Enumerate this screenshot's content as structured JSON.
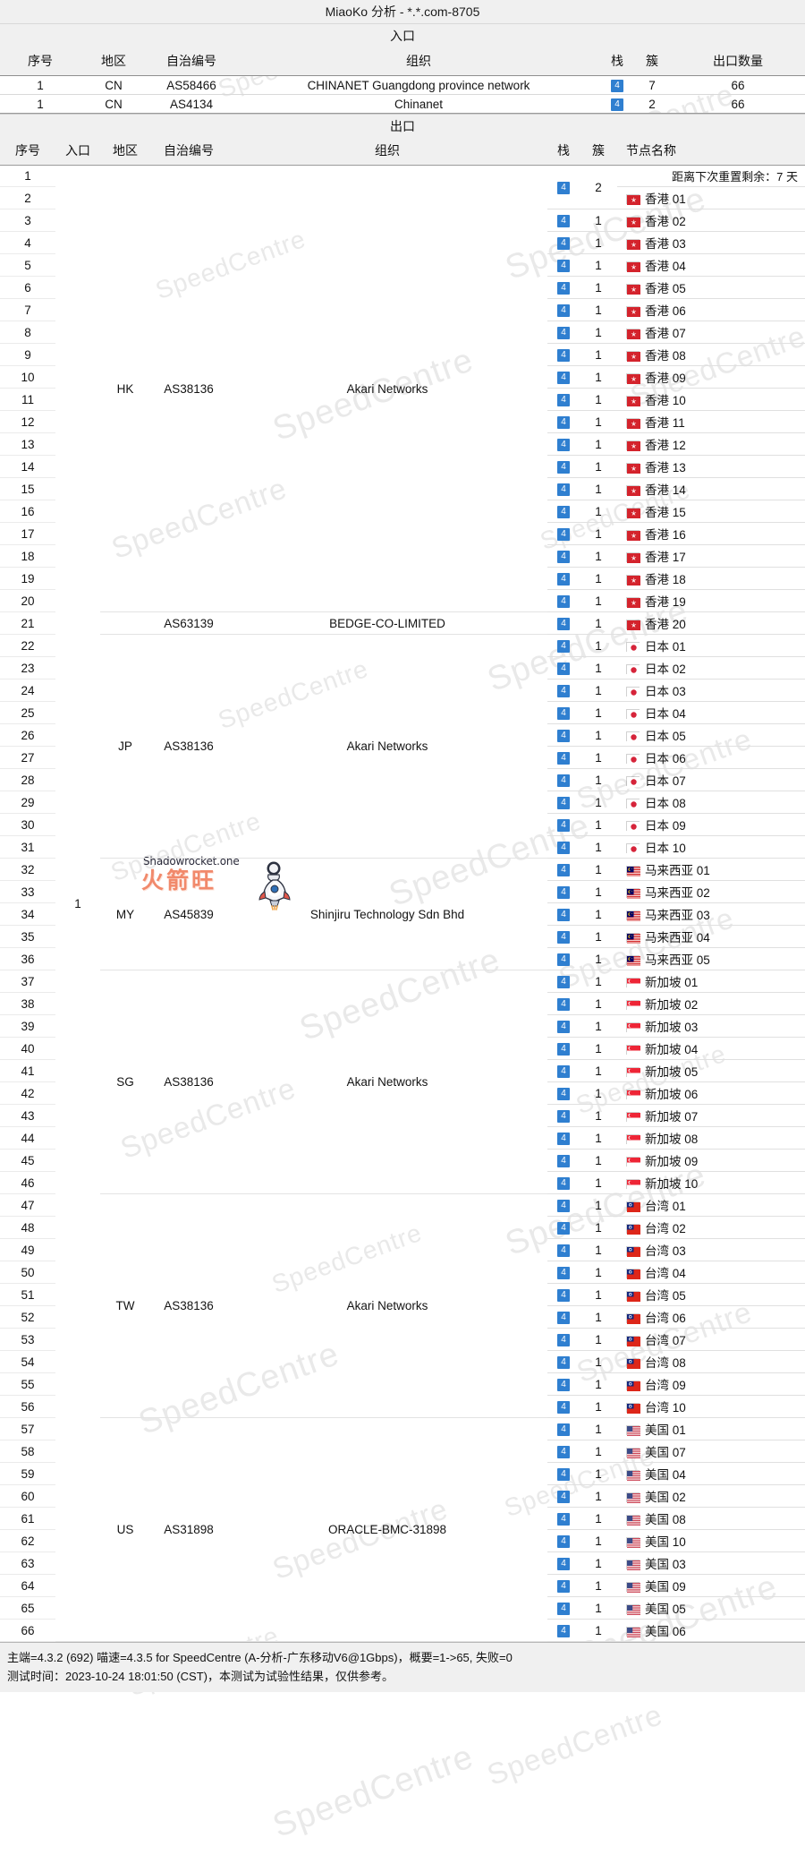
{
  "window": {
    "title": "MiaoKo 分析 - *.*.com-8705"
  },
  "colors": {
    "stack_badge": "#2f7fd0",
    "header_bg": "#f0f0f0",
    "watermark": "#e9e9e9"
  },
  "watermark": {
    "text": "SpeedCentre"
  },
  "logo": {
    "site": "Shadowrocket.one",
    "cn": "火箭旺",
    "icon": "rocket-icon"
  },
  "entry_section": {
    "banner": "入口",
    "headers": {
      "index": "序号",
      "region": "地区",
      "asn": "自治编号",
      "org": "组织",
      "stack": "栈",
      "cluster": "簇",
      "exit_count": "出口数量"
    },
    "rows": [
      {
        "index": "1",
        "region": "CN",
        "asn": "AS58466",
        "org": "CHINANET Guangdong province network",
        "stack": "4",
        "cluster": "7",
        "exit_count": "66"
      },
      {
        "index": "1",
        "region": "CN",
        "asn": "AS4134",
        "org": "Chinanet",
        "stack": "4",
        "cluster": "2",
        "exit_count": "66"
      }
    ]
  },
  "exit_section": {
    "banner": "出口",
    "headers": {
      "index": "序号",
      "entry": "入口",
      "region": "地区",
      "asn": "自治编号",
      "org": "组织",
      "stack": "栈",
      "cluster": "簇",
      "node_name": "节点名称"
    },
    "entry_value": "1",
    "reset_note": "距离下次重置剩余：7 天",
    "first_group": {
      "stack": "4",
      "cluster": "2"
    },
    "groups": [
      {
        "region": "HK",
        "asn": "AS38136",
        "org": "Akari Networks",
        "rows": [
          {
            "index": "1",
            "stack": "4",
            "cluster": "2",
            "node": "",
            "flag": "",
            "merged_with_next": true
          },
          {
            "index": "2",
            "stack": "",
            "cluster": "",
            "node": "香港 01",
            "flag": "hk-flag"
          },
          {
            "index": "3",
            "stack": "4",
            "cluster": "1",
            "node": "香港 02",
            "flag": "hk-flag"
          },
          {
            "index": "4",
            "stack": "4",
            "cluster": "1",
            "node": "香港 03",
            "flag": "hk-flag"
          },
          {
            "index": "5",
            "stack": "4",
            "cluster": "1",
            "node": "香港 04",
            "flag": "hk-flag"
          },
          {
            "index": "6",
            "stack": "4",
            "cluster": "1",
            "node": "香港 05",
            "flag": "hk-flag"
          },
          {
            "index": "7",
            "stack": "4",
            "cluster": "1",
            "node": "香港 06",
            "flag": "hk-flag"
          },
          {
            "index": "8",
            "stack": "4",
            "cluster": "1",
            "node": "香港 07",
            "flag": "hk-flag"
          },
          {
            "index": "9",
            "stack": "4",
            "cluster": "1",
            "node": "香港 08",
            "flag": "hk-flag"
          },
          {
            "index": "10",
            "stack": "4",
            "cluster": "1",
            "node": "香港 09",
            "flag": "hk-flag"
          },
          {
            "index": "11",
            "stack": "4",
            "cluster": "1",
            "node": "香港 10",
            "flag": "hk-flag"
          },
          {
            "index": "12",
            "stack": "4",
            "cluster": "1",
            "node": "香港 11",
            "flag": "hk-flag"
          },
          {
            "index": "13",
            "stack": "4",
            "cluster": "1",
            "node": "香港 12",
            "flag": "hk-flag"
          },
          {
            "index": "14",
            "stack": "4",
            "cluster": "1",
            "node": "香港 13",
            "flag": "hk-flag"
          },
          {
            "index": "15",
            "stack": "4",
            "cluster": "1",
            "node": "香港 14",
            "flag": "hk-flag"
          },
          {
            "index": "16",
            "stack": "4",
            "cluster": "1",
            "node": "香港 15",
            "flag": "hk-flag"
          },
          {
            "index": "17",
            "stack": "4",
            "cluster": "1",
            "node": "香港 16",
            "flag": "hk-flag"
          },
          {
            "index": "18",
            "stack": "4",
            "cluster": "1",
            "node": "香港 17",
            "flag": "hk-flag"
          },
          {
            "index": "19",
            "stack": "4",
            "cluster": "1",
            "node": "香港 18",
            "flag": "hk-flag"
          },
          {
            "index": "20",
            "stack": "4",
            "cluster": "1",
            "node": "香港 19",
            "flag": "hk-flag"
          }
        ]
      },
      {
        "region": "",
        "asn": "AS63139",
        "org": "BEDGE-CO-LIMITED",
        "rows": [
          {
            "index": "21",
            "stack": "4",
            "cluster": "1",
            "node": "香港 20",
            "flag": "hk-flag"
          }
        ]
      },
      {
        "region": "JP",
        "asn": "AS38136",
        "org": "Akari Networks",
        "rows": [
          {
            "index": "22",
            "stack": "4",
            "cluster": "1",
            "node": "日本 01",
            "flag": "jp-flag"
          },
          {
            "index": "23",
            "stack": "4",
            "cluster": "1",
            "node": "日本 02",
            "flag": "jp-flag"
          },
          {
            "index": "24",
            "stack": "4",
            "cluster": "1",
            "node": "日本 03",
            "flag": "jp-flag"
          },
          {
            "index": "25",
            "stack": "4",
            "cluster": "1",
            "node": "日本 04",
            "flag": "jp-flag"
          },
          {
            "index": "26",
            "stack": "4",
            "cluster": "1",
            "node": "日本 05",
            "flag": "jp-flag"
          },
          {
            "index": "27",
            "stack": "4",
            "cluster": "1",
            "node": "日本 06",
            "flag": "jp-flag"
          },
          {
            "index": "28",
            "stack": "4",
            "cluster": "1",
            "node": "日本 07",
            "flag": "jp-flag"
          },
          {
            "index": "29",
            "stack": "4",
            "cluster": "1",
            "node": "日本 08",
            "flag": "jp-flag"
          },
          {
            "index": "30",
            "stack": "4",
            "cluster": "1",
            "node": "日本 09",
            "flag": "jp-flag"
          },
          {
            "index": "31",
            "stack": "4",
            "cluster": "1",
            "node": "日本 10",
            "flag": "jp-flag"
          }
        ]
      },
      {
        "region": "MY",
        "asn": "AS45839",
        "org": "Shinjiru Technology Sdn Bhd",
        "rows": [
          {
            "index": "32",
            "stack": "4",
            "cluster": "1",
            "node": "马来西亚 01",
            "flag": "my-flag"
          },
          {
            "index": "33",
            "stack": "4",
            "cluster": "1",
            "node": "马来西亚 02",
            "flag": "my-flag"
          },
          {
            "index": "34",
            "stack": "4",
            "cluster": "1",
            "node": "马来西亚 03",
            "flag": "my-flag"
          },
          {
            "index": "35",
            "stack": "4",
            "cluster": "1",
            "node": "马来西亚 04",
            "flag": "my-flag"
          },
          {
            "index": "36",
            "stack": "4",
            "cluster": "1",
            "node": "马来西亚 05",
            "flag": "my-flag"
          }
        ]
      },
      {
        "region": "SG",
        "asn": "AS38136",
        "org": "Akari Networks",
        "rows": [
          {
            "index": "37",
            "stack": "4",
            "cluster": "1",
            "node": "新加坡 01",
            "flag": "sg-flag"
          },
          {
            "index": "38",
            "stack": "4",
            "cluster": "1",
            "node": "新加坡 02",
            "flag": "sg-flag"
          },
          {
            "index": "39",
            "stack": "4",
            "cluster": "1",
            "node": "新加坡 03",
            "flag": "sg-flag"
          },
          {
            "index": "40",
            "stack": "4",
            "cluster": "1",
            "node": "新加坡 04",
            "flag": "sg-flag"
          },
          {
            "index": "41",
            "stack": "4",
            "cluster": "1",
            "node": "新加坡 05",
            "flag": "sg-flag"
          },
          {
            "index": "42",
            "stack": "4",
            "cluster": "1",
            "node": "新加坡 06",
            "flag": "sg-flag"
          },
          {
            "index": "43",
            "stack": "4",
            "cluster": "1",
            "node": "新加坡 07",
            "flag": "sg-flag"
          },
          {
            "index": "44",
            "stack": "4",
            "cluster": "1",
            "node": "新加坡 08",
            "flag": "sg-flag"
          },
          {
            "index": "45",
            "stack": "4",
            "cluster": "1",
            "node": "新加坡 09",
            "flag": "sg-flag"
          },
          {
            "index": "46",
            "stack": "4",
            "cluster": "1",
            "node": "新加坡 10",
            "flag": "sg-flag"
          }
        ]
      },
      {
        "region": "TW",
        "asn": "AS38136",
        "org": "Akari Networks",
        "rows": [
          {
            "index": "47",
            "stack": "4",
            "cluster": "1",
            "node": "台湾 01",
            "flag": "tw-flag"
          },
          {
            "index": "48",
            "stack": "4",
            "cluster": "1",
            "node": "台湾 02",
            "flag": "tw-flag"
          },
          {
            "index": "49",
            "stack": "4",
            "cluster": "1",
            "node": "台湾 03",
            "flag": "tw-flag"
          },
          {
            "index": "50",
            "stack": "4",
            "cluster": "1",
            "node": "台湾 04",
            "flag": "tw-flag"
          },
          {
            "index": "51",
            "stack": "4",
            "cluster": "1",
            "node": "台湾 05",
            "flag": "tw-flag"
          },
          {
            "index": "52",
            "stack": "4",
            "cluster": "1",
            "node": "台湾 06",
            "flag": "tw-flag"
          },
          {
            "index": "53",
            "stack": "4",
            "cluster": "1",
            "node": "台湾 07",
            "flag": "tw-flag"
          },
          {
            "index": "54",
            "stack": "4",
            "cluster": "1",
            "node": "台湾 08",
            "flag": "tw-flag"
          },
          {
            "index": "55",
            "stack": "4",
            "cluster": "1",
            "node": "台湾 09",
            "flag": "tw-flag"
          },
          {
            "index": "56",
            "stack": "4",
            "cluster": "1",
            "node": "台湾 10",
            "flag": "tw-flag"
          }
        ]
      },
      {
        "region": "US",
        "asn": "AS31898",
        "org": "ORACLE-BMC-31898",
        "rows": [
          {
            "index": "57",
            "stack": "4",
            "cluster": "1",
            "node": "美国 01",
            "flag": "us-flag"
          },
          {
            "index": "58",
            "stack": "4",
            "cluster": "1",
            "node": "美国 07",
            "flag": "us-flag"
          },
          {
            "index": "59",
            "stack": "4",
            "cluster": "1",
            "node": "美国 04",
            "flag": "us-flag"
          },
          {
            "index": "60",
            "stack": "4",
            "cluster": "1",
            "node": "美国 02",
            "flag": "us-flag"
          },
          {
            "index": "61",
            "stack": "4",
            "cluster": "1",
            "node": "美国 08",
            "flag": "us-flag"
          },
          {
            "index": "62",
            "stack": "4",
            "cluster": "1",
            "node": "美国 10",
            "flag": "us-flag"
          },
          {
            "index": "63",
            "stack": "4",
            "cluster": "1",
            "node": "美国 03",
            "flag": "us-flag"
          },
          {
            "index": "64",
            "stack": "4",
            "cluster": "1",
            "node": "美国 09",
            "flag": "us-flag"
          },
          {
            "index": "65",
            "stack": "4",
            "cluster": "1",
            "node": "美国 05",
            "flag": "us-flag"
          },
          {
            "index": "66",
            "stack": "4",
            "cluster": "1",
            "node": "美国 06",
            "flag": "us-flag"
          }
        ]
      }
    ]
  },
  "footer": {
    "line1": "主端=4.3.2 (692) 喵速=4.3.5 for SpeedCentre (A-分析-广东移动V6@1Gbps)，概要=1->65, 失败=0",
    "line2": "测试时间：2023-10-24 18:01:50 (CST)，本测试为试验性结果，仅供参考。"
  }
}
